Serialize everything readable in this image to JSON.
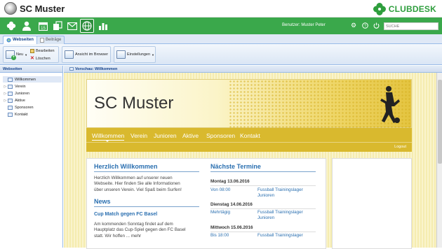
{
  "app": {
    "club_name": "SC Muster",
    "brand_name": "CLUBDESK"
  },
  "topnav": {
    "user_label": "Benutzer: Muster Peter",
    "search_placeholder": "SUCHE",
    "icons": [
      "clover-icon",
      "person-icon",
      "calendar-icon",
      "documents-icon",
      "mail-icon",
      "globe-icon",
      "statistics-icon"
    ],
    "calendar_day": "15",
    "active_icon": "globe-icon"
  },
  "tabs": [
    {
      "label": "Webseiten",
      "active": true
    },
    {
      "label": "Beiträge",
      "active": false
    }
  ],
  "toolbar": {
    "new_label": "Neu",
    "edit_label": "Bearbeiten",
    "delete_label": "Löschen",
    "browser_label": "Ansicht im Browser",
    "settings_label": "Einstellungen"
  },
  "sidebar": {
    "title": "Webseiten",
    "items": [
      {
        "label": "Willkommen",
        "expandable": false,
        "selected": true
      },
      {
        "label": "Verein",
        "expandable": true,
        "selected": false
      },
      {
        "label": "Junioren",
        "expandable": true,
        "selected": false
      },
      {
        "label": "Aktive",
        "expandable": true,
        "selected": false
      },
      {
        "label": "Sponsoren",
        "expandable": false,
        "selected": false
      },
      {
        "label": "Kontakt",
        "expandable": false,
        "selected": false
      }
    ]
  },
  "preview": {
    "title": "Vorschau: Willkommen",
    "site_title": "SC Muster",
    "menu": [
      "Willkommen",
      "Verein",
      "Junioren",
      "Aktive",
      "Sponsoren",
      "Kontakt"
    ],
    "logout": "Logout",
    "welcome_heading": "Herzlich Willkommen",
    "welcome_text": [
      "Herzlich Willkommen auf unserer neuen",
      "Webseite. Hier finden Sie alle Informationen",
      "über unseren Verein. Viel Spaß beim Surfen!"
    ],
    "news_heading": "News",
    "news_title": "Cup Match gegen FC Basel",
    "news_text": [
      "Am kommenden Sonntag findet auf dem",
      "Hauptplatz das Cup-Spiel gegen den FC Basel",
      "statt. Wir hoffen ... mehr"
    ],
    "events_heading": "Nächste Termine",
    "events": [
      {
        "date": "Montag 13.06.2016",
        "time": "Von 08:00",
        "text": [
          "Fussball Trainingslager",
          "Junioren"
        ]
      },
      {
        "date": "Dienstag 14.06.2016",
        "time": "Mehrtägig",
        "text": [
          "Fussball Trainingslager",
          "Junioren"
        ]
      },
      {
        "date": "Mittwoch 15.06.2016",
        "time": "Bis 18:00",
        "text": [
          "Fussball Trainingslager",
          ""
        ]
      }
    ]
  },
  "colors": {
    "green": "#3aa84b",
    "gold": "#d9b92e",
    "link_blue": "#2a6fb0",
    "panel_blue": "#15428b"
  }
}
